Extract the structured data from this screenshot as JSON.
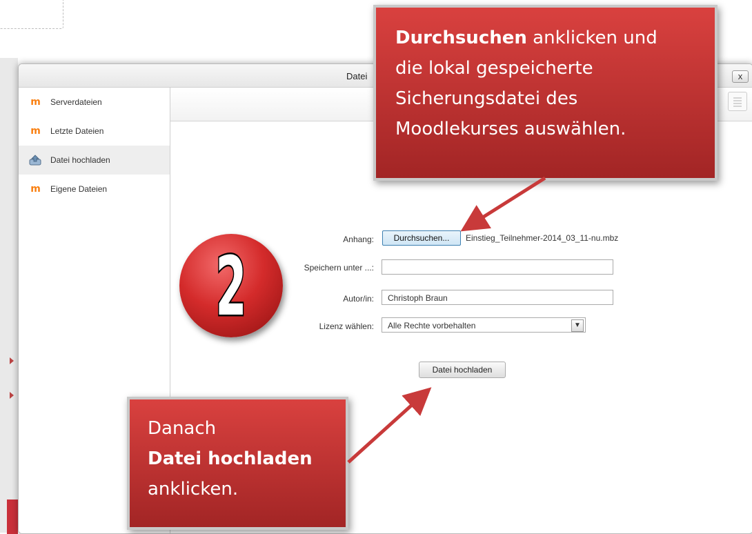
{
  "dialog": {
    "title": "Datei",
    "close_label": "x"
  },
  "sidebar": {
    "items": [
      {
        "label": "Serverdateien",
        "icon": "moodle-icon"
      },
      {
        "label": "Letzte Dateien",
        "icon": "moodle-icon"
      },
      {
        "label": "Datei hochladen",
        "icon": "upload-icon",
        "active": true
      },
      {
        "label": "Eigene Dateien",
        "icon": "moodle-icon"
      }
    ]
  },
  "form": {
    "attachment_label": "Anhang:",
    "browse_button": "Durchsuchen...",
    "selected_file": "Einstieg_Teilnehmer-2014_03_11-nu.mbz",
    "save_as_label": "Speichern unter ...:",
    "save_as_value": "",
    "author_label": "Autor/in:",
    "author_value": "Christoph Braun",
    "license_label": "Lizenz wählen:",
    "license_value": "Alle Rechte vorbehalten",
    "upload_button": "Datei hochladen"
  },
  "step_badge": "2",
  "callout_browse": {
    "bold": "Durchsuchen",
    "rest_line1": " anklicken und",
    "line2": "die lokal gespeicherte",
    "line3": "Sicherungsdatei des",
    "line4": "Moodlekurses auswählen."
  },
  "callout_upload": {
    "line1": "Danach",
    "bold": "Datei hochladen",
    "line3": "anklicken."
  },
  "colors": {
    "callout_red": "#c33232",
    "moodle_orange": "#f98012",
    "browse_border": "#3c7fb1"
  }
}
